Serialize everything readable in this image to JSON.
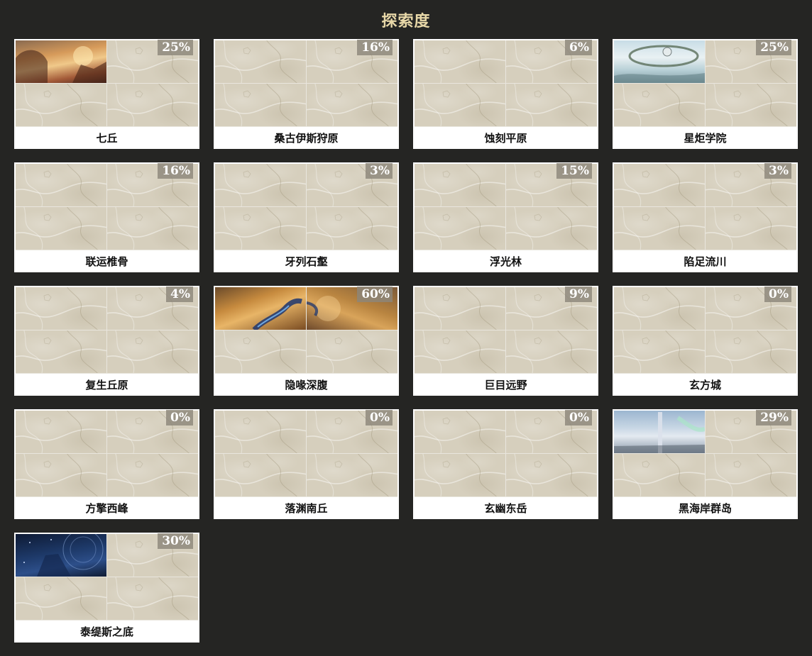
{
  "title": "探索度",
  "regions": [
    {
      "name": "七丘",
      "percent": "25%",
      "explored": [
        "sunset",
        "map",
        "map",
        "map"
      ]
    },
    {
      "name": "桑古伊斯狩原",
      "percent": "16%",
      "explored": [
        "map",
        "map",
        "map",
        "map"
      ]
    },
    {
      "name": "蚀刻平原",
      "percent": "6%",
      "explored": [
        "map",
        "map",
        "map",
        "map"
      ]
    },
    {
      "name": "星炬学院",
      "percent": "25%",
      "explored": [
        "sky",
        "map",
        "map",
        "map"
      ]
    },
    {
      "name": "联运椎骨",
      "percent": "16%",
      "explored": [
        "map",
        "map",
        "map",
        "map"
      ]
    },
    {
      "name": "牙列石壑",
      "percent": "3%",
      "explored": [
        "map",
        "map",
        "map",
        "map"
      ]
    },
    {
      "name": "浮光林",
      "percent": "15%",
      "explored": [
        "map",
        "map",
        "map",
        "map"
      ]
    },
    {
      "name": "陷足流川",
      "percent": "3%",
      "explored": [
        "map",
        "map",
        "map",
        "map"
      ]
    },
    {
      "name": "复生丘原",
      "percent": "4%",
      "explored": [
        "map",
        "map",
        "map",
        "map"
      ]
    },
    {
      "name": "隐喙深腹",
      "percent": "60%",
      "explored": [
        "dragon-left",
        "dragon-right",
        "map",
        "map"
      ]
    },
    {
      "name": "巨目远野",
      "percent": "9%",
      "explored": [
        "map",
        "map",
        "map",
        "map"
      ]
    },
    {
      "name": "玄方城",
      "percent": "0%",
      "explored": [
        "map",
        "map",
        "map",
        "map"
      ]
    },
    {
      "name": "方擎西峰",
      "percent": "0%",
      "explored": [
        "map",
        "map",
        "map",
        "map"
      ]
    },
    {
      "name": "落渊南丘",
      "percent": "0%",
      "explored": [
        "map",
        "map",
        "map",
        "map"
      ]
    },
    {
      "name": "玄幽东岳",
      "percent": "0%",
      "explored": [
        "map",
        "map",
        "map",
        "map"
      ]
    },
    {
      "name": "黑海岸群岛",
      "percent": "29%",
      "explored": [
        "tower",
        "map",
        "map",
        "map"
      ]
    },
    {
      "name": "泰缇斯之底",
      "percent": "30%",
      "explored": [
        "space",
        "map",
        "map",
        "map"
      ]
    }
  ]
}
